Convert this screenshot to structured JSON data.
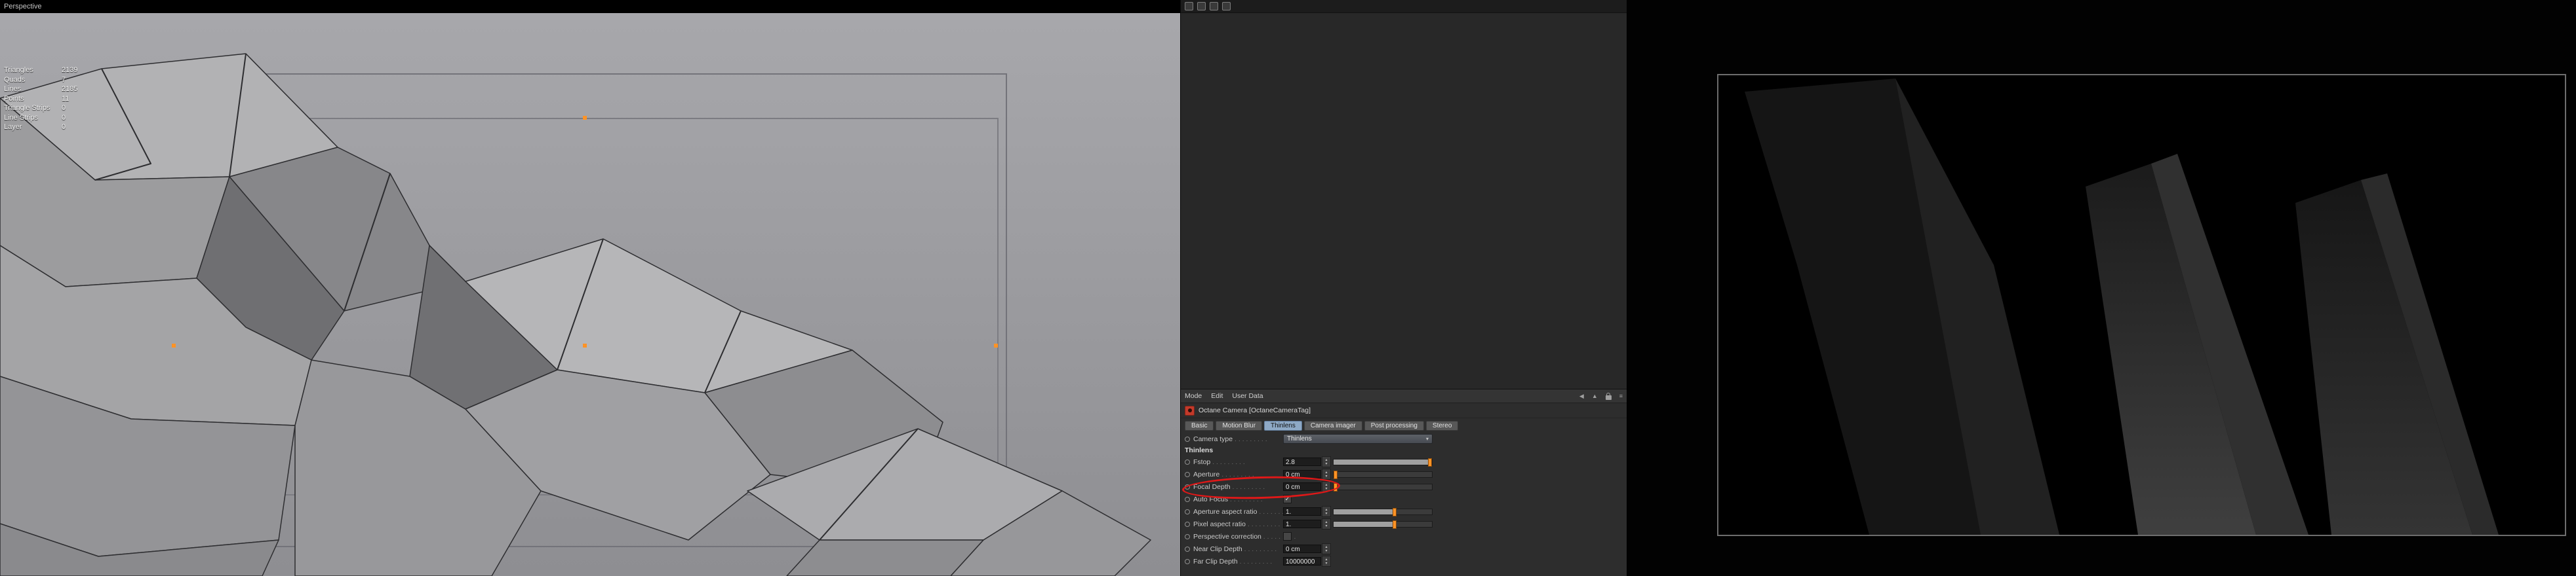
{
  "viewport": {
    "view_label": "Perspective",
    "stats": [
      {
        "label": "Triangles",
        "value": "2139"
      },
      {
        "label": "Quads",
        "value": "7"
      },
      {
        "label": "Lines",
        "value": "2185"
      },
      {
        "label": "Points",
        "value": "11"
      },
      {
        "label": "Triangle Strips",
        "value": "0"
      },
      {
        "label": "Line Strips",
        "value": "0"
      },
      {
        "label": "Layer",
        "value": "0"
      }
    ]
  },
  "attribute_manager": {
    "menu": [
      "Mode",
      "Edit",
      "User Data"
    ],
    "title": "Octane Camera [OctaneCameraTag]",
    "tabs": [
      {
        "label": "Basic",
        "selected": false
      },
      {
        "label": "Motion Blur",
        "selected": false
      },
      {
        "label": "Thinlens",
        "selected": true
      },
      {
        "label": "Camera imager",
        "selected": false
      },
      {
        "label": "Post processing",
        "selected": false
      },
      {
        "label": "Stereo",
        "selected": false
      }
    ],
    "camera_type_label": "Camera type",
    "camera_type_value": "Thinlens",
    "group_label": "Thinlens",
    "params": [
      {
        "label": "Fstop",
        "value": "2.8",
        "control": "slider",
        "slider_pos": 1.0
      },
      {
        "label": "Aperture",
        "value": "0 cm",
        "control": "slider",
        "slider_pos": 0.0
      },
      {
        "label": "Focal Depth",
        "value": "0 cm",
        "control": "slider",
        "slider_pos": 0.0,
        "annotated": true
      },
      {
        "label": "Auto Focus",
        "control": "checkbox",
        "checked": true
      },
      {
        "label": "Aperture aspect ratio",
        "value": "1.",
        "control": "slider",
        "slider_pos": 0.62
      },
      {
        "label": "Pixel aspect ratio",
        "value": "1.",
        "control": "slider",
        "slider_pos": 0.62
      },
      {
        "label": "Perspective correction",
        "control": "checkbox",
        "checked": false
      },
      {
        "label": "Near Clip Depth",
        "value": "0 cm",
        "control": "spin"
      },
      {
        "label": "Far Clip Depth",
        "value": "10000000",
        "control": "spin"
      }
    ],
    "annotation": {
      "shape": "ellipse",
      "target": "Focal Depth",
      "color": "#e01818"
    }
  },
  "icons": {
    "back_arrow": "◀",
    "up_arrow": "▲",
    "menu": "≡",
    "dropdown_arrow": "▾",
    "spinner_up": "▴",
    "spinner_down": "▾",
    "checkmark": "✓"
  },
  "colors": {
    "accent_orange": "#ff9326",
    "tab_selected": "#8ea9c6",
    "annotation_red": "#e01818",
    "octane_tag_red": "#c33a2a",
    "viewport_bg": "#9c9ca0"
  }
}
